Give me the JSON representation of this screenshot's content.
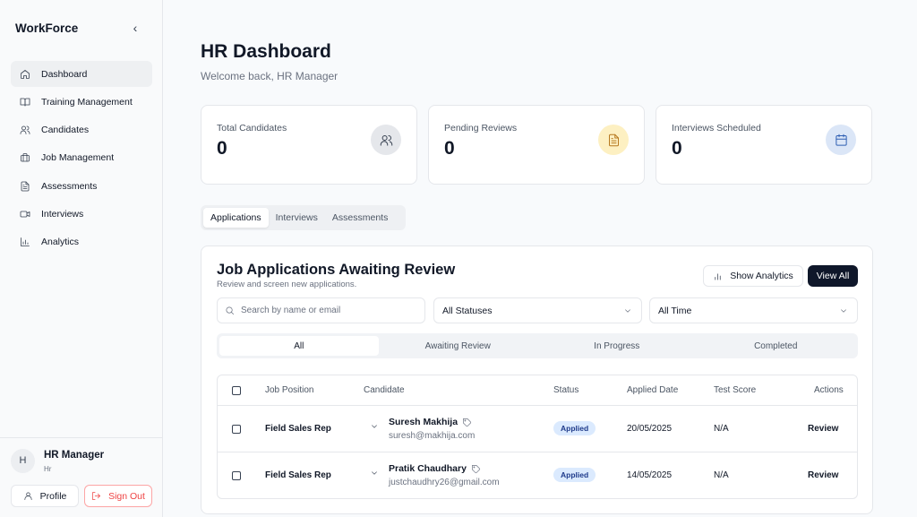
{
  "app": {
    "name": "WorkForce"
  },
  "sidebar": {
    "items": [
      {
        "label": "Dashboard",
        "icon": "home-icon",
        "active": true
      },
      {
        "label": "Training Management",
        "icon": "book-icon"
      },
      {
        "label": "Candidates",
        "icon": "users-icon"
      },
      {
        "label": "Job Management",
        "icon": "briefcase-icon"
      },
      {
        "label": "Assessments",
        "icon": "document-icon"
      },
      {
        "label": "Interviews",
        "icon": "video-icon"
      },
      {
        "label": "Analytics",
        "icon": "bar-chart-icon"
      }
    ],
    "user": {
      "initial": "H",
      "name": "HR Manager",
      "role": "Hr"
    },
    "profile_label": "Profile",
    "signout_label": "Sign Out"
  },
  "header": {
    "title": "HR Dashboard",
    "subtitle": "Welcome back, HR Manager"
  },
  "stats": [
    {
      "label": "Total Candidates",
      "value": "0",
      "icon": "users-icon",
      "icon_bg": "#e5e7eb",
      "icon_color": "#374151"
    },
    {
      "label": "Pending Reviews",
      "value": "0",
      "icon": "document-icon",
      "icon_bg": "#fdf0c2",
      "icon_color": "#b7791f"
    },
    {
      "label": "Interviews Scheduled",
      "value": "0",
      "icon": "calendar-icon",
      "icon_bg": "#dbe6f7",
      "icon_color": "#2f5fb3"
    }
  ],
  "tabs": [
    "Applications",
    "Interviews",
    "Assessments"
  ],
  "panel": {
    "title": "Job Applications Awaiting Review",
    "subtitle": "Review and screen new applications.",
    "analytics_label": "Show Analytics",
    "viewall_label": "View All",
    "search_placeholder": "Search by name or email",
    "status_filter": "All Statuses",
    "time_filter": "All Time",
    "subtabs": [
      "All",
      "Awaiting Review",
      "In Progress",
      "Completed"
    ],
    "columns": [
      "Job Position",
      "Candidate",
      "Status",
      "Applied Date",
      "Test Score",
      "Actions"
    ],
    "rows": [
      {
        "position": "Field Sales Rep",
        "name": "Suresh Makhija",
        "email": "suresh@makhija.com",
        "status": "Applied",
        "date": "20/05/2025",
        "score": "N/A",
        "action": "Review"
      },
      {
        "position": "Field Sales Rep",
        "name": "Pratik Chaudhary",
        "email": "justchaudhry26@gmail.com",
        "status": "Applied",
        "date": "14/05/2025",
        "score": "N/A",
        "action": "Review"
      }
    ]
  }
}
